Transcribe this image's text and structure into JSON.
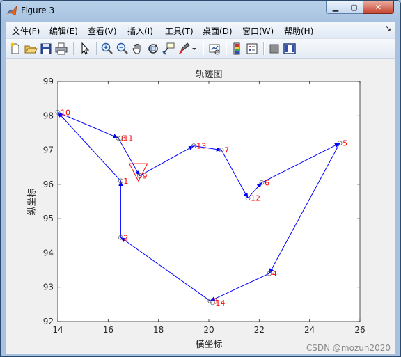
{
  "window": {
    "title": "Figure 3"
  },
  "menu": {
    "items": [
      "文件(F)",
      "编辑(E)",
      "查看(V)",
      "插入(I)",
      "工具(T)",
      "桌面(D)",
      "窗口(W)",
      "帮助(H)"
    ],
    "overflow": "↘"
  },
  "toolbar": {
    "icons": [
      "new-figure-icon",
      "open-file-icon",
      "save-icon",
      "print-icon",
      "pointer-icon",
      "zoom-in-icon",
      "zoom-out-icon",
      "pan-hand-icon",
      "rotate-3d-icon",
      "data-cursor-icon",
      "brush-icon",
      "brush-dropdown-icon",
      "link-plot-icon",
      "colorbar-icon",
      "legend-icon",
      "hide-plot-tools-icon",
      "show-plot-tools-icon"
    ]
  },
  "watermark": "CSDN @mozun2020",
  "chart_data": {
    "type": "line",
    "title": "轨迹图",
    "xlabel": "横坐标",
    "ylabel": "纵坐标",
    "xlim": [
      14,
      26
    ],
    "ylim": [
      92,
      99
    ],
    "xticks": [
      "14",
      "16",
      "18",
      "20",
      "22",
      "24",
      "26"
    ],
    "yticks": [
      "92",
      "93",
      "94",
      "95",
      "96",
      "97",
      "98",
      "99"
    ],
    "grid": false,
    "points": [
      {
        "label": "1",
        "x": 16.5,
        "y": 96.1
      },
      {
        "label": "2",
        "x": 16.5,
        "y": 94.45
      },
      {
        "label": "3",
        "x": 20.05,
        "y": 92.6
      },
      {
        "label": "4",
        "x": 22.4,
        "y": 93.4
      },
      {
        "label": "5",
        "x": 25.2,
        "y": 97.2
      },
      {
        "label": "6",
        "x": 22.1,
        "y": 96.05
      },
      {
        "label": "7",
        "x": 20.5,
        "y": 97.0
      },
      {
        "label": "8",
        "x": 16.4,
        "y": 97.35
      },
      {
        "label": "9",
        "x": 17.25,
        "y": 96.25
      },
      {
        "label": "10",
        "x": 14.0,
        "y": 98.1
      },
      {
        "label": "11",
        "x": 16.5,
        "y": 97.35
      },
      {
        "label": "12",
        "x": 21.55,
        "y": 95.6
      },
      {
        "label": "13",
        "x": 19.4,
        "y": 97.12
      },
      {
        "label": "14",
        "x": 20.15,
        "y": 92.55
      }
    ],
    "route": [
      {
        "x": 17.25,
        "y": 96.25
      },
      {
        "x": 19.4,
        "y": 97.12
      },
      {
        "x": 20.5,
        "y": 97.0
      },
      {
        "x": 21.55,
        "y": 95.6
      },
      {
        "x": 22.1,
        "y": 96.05
      },
      {
        "x": 25.2,
        "y": 97.2
      },
      {
        "x": 22.4,
        "y": 93.4
      },
      {
        "x": 20.05,
        "y": 92.6
      },
      {
        "x": 16.5,
        "y": 94.45
      },
      {
        "x": 16.5,
        "y": 96.1
      },
      {
        "x": 14.0,
        "y": 98.1
      },
      {
        "x": 16.4,
        "y": 97.35
      },
      {
        "x": 17.25,
        "y": 96.25
      }
    ],
    "start_marker": {
      "x": 17.2,
      "y": 96.3,
      "shape": "triangle-down",
      "color": "#ff0000"
    },
    "colors": {
      "route": "#0000ff",
      "labels": "#ff0000",
      "points": "#666666"
    }
  }
}
